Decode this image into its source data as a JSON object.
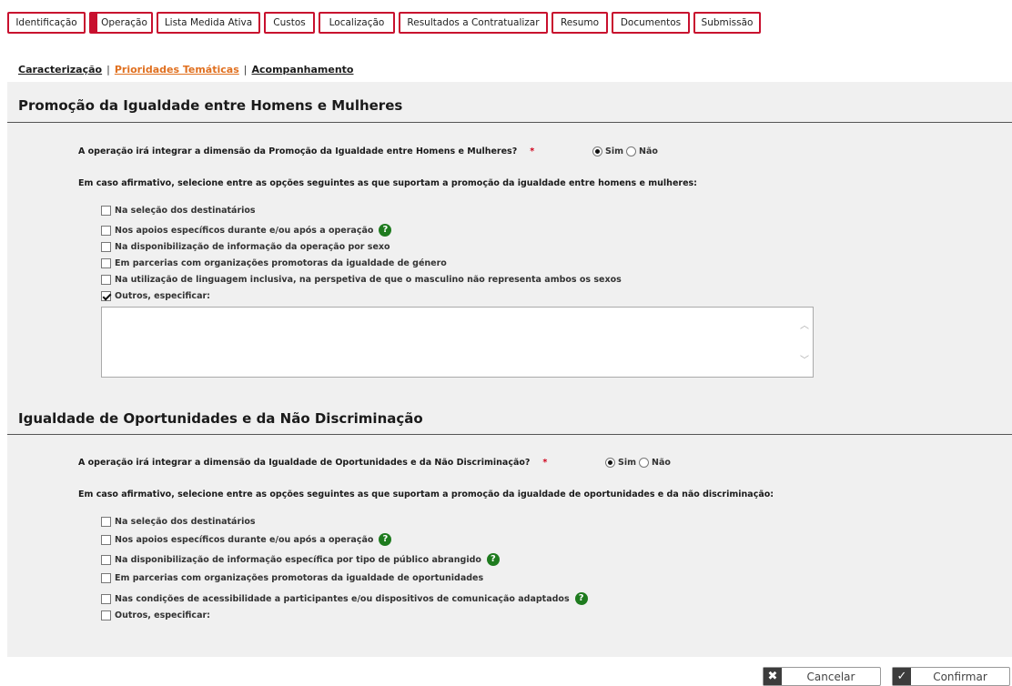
{
  "tabs": [
    {
      "label": "Identificação",
      "active": false
    },
    {
      "label": "Operação",
      "active": true
    },
    {
      "label": "Lista Medida Ativa",
      "active": false
    },
    {
      "label": "Custos",
      "active": false
    },
    {
      "label": "Localização",
      "active": false
    },
    {
      "label": "Resultados a Contratualizar",
      "active": false
    },
    {
      "label": "Resumo",
      "active": false
    },
    {
      "label": "Documentos",
      "active": false
    },
    {
      "label": "Submissão",
      "active": false
    }
  ],
  "subnav": {
    "items": [
      "Caracterização",
      "Prioridades Temáticas",
      "Acompanhamento"
    ],
    "separator": "|",
    "current": "Prioridades Temáticas"
  },
  "section1": {
    "title": "Promoção da Igualdade entre Homens e Mulheres",
    "question": "A operação irá integrar a dimensão da Promoção da Igualdade entre Homens e Mulheres?",
    "required_mark": "*",
    "radio_yes": "Sim",
    "radio_no": "Não",
    "selected": "Sim",
    "intro": "Em caso afirmativo, selecione entre as opções seguintes as que suportam a promoção da igualdade entre homens e mulheres:",
    "options": [
      {
        "label": "Na seleção dos destinatários",
        "checked": false,
        "help": false
      },
      {
        "label": "Nos apoios específicos durante e/ou após a operação",
        "checked": false,
        "help": true
      },
      {
        "label": "Na disponibilização de informação da operação por sexo",
        "checked": false,
        "help": false
      },
      {
        "label": "Em parcerias com organizações promotoras da igualdade de género",
        "checked": false,
        "help": false
      },
      {
        "label": "Na utilização de linguagem inclusiva, na perspetiva de que o masculino não representa ambos os sexos",
        "checked": false,
        "help": false
      },
      {
        "label": "Outros, especificar:",
        "checked": true,
        "help": false
      }
    ],
    "other_text": ""
  },
  "section2": {
    "title": "Igualdade de Oportunidades e da Não Discriminação",
    "question": "A operação irá integrar a dimensão da Igualdade de Oportunidades e da Não Discriminação?",
    "required_mark": "*",
    "radio_yes": "Sim",
    "radio_no": "Não",
    "selected": "Sim",
    "intro": "Em caso afirmativo, selecione entre as opções seguintes as que suportam a promoção da igualdade de oportunidades e da não discriminação:",
    "options": [
      {
        "label": "Na seleção dos destinatários",
        "checked": false,
        "help": false
      },
      {
        "label": "Nos apoios específicos durante e/ou após a operação",
        "checked": false,
        "help": true
      },
      {
        "label": "Na disponibilização de informação específica por tipo de público abrangido",
        "checked": false,
        "help": true
      },
      {
        "label": "Em parcerias com organizações promotoras da igualdade de oportunidades",
        "checked": false,
        "help": false
      },
      {
        "label": "Nas condições de acessibilidade a participantes e/ou dispositivos de comunicação adaptados",
        "checked": false,
        "help": true
      },
      {
        "label": "Outros, especificar:",
        "checked": false,
        "help": false
      }
    ]
  },
  "help_glyph": "?",
  "footer": {
    "cancel_label": "Cancelar",
    "cancel_icon": "✖",
    "confirm_label": "Confirmar",
    "confirm_icon": "✓"
  }
}
